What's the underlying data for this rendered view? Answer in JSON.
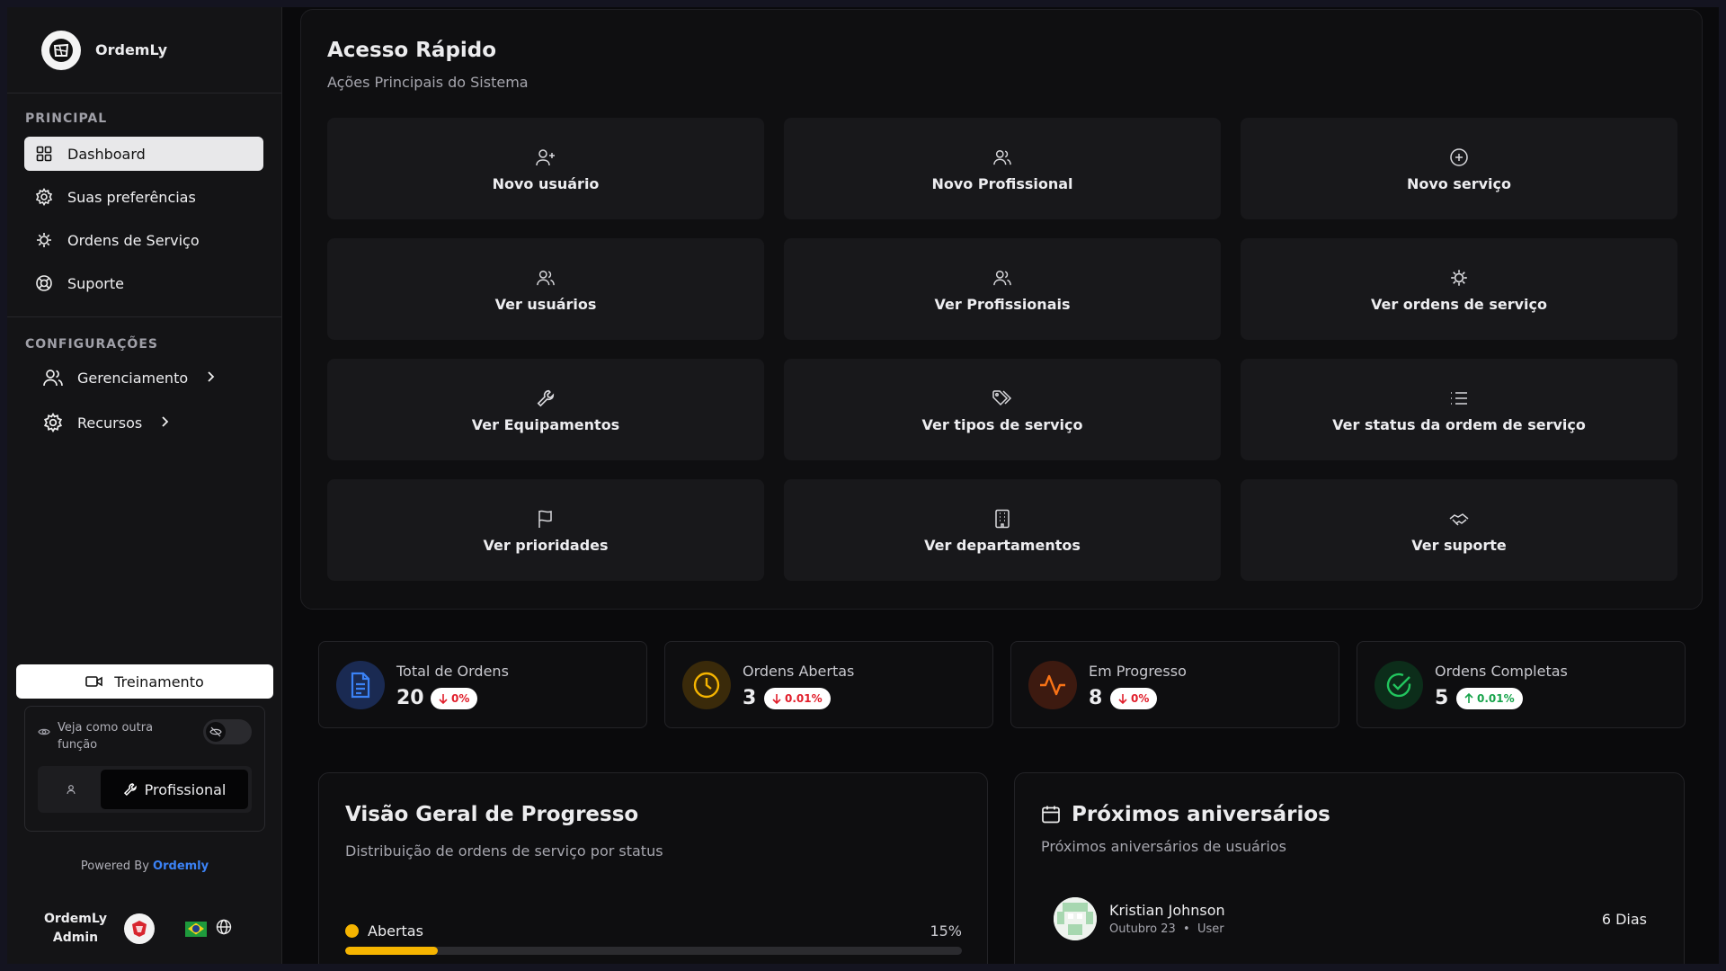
{
  "app": {
    "name": "OrdemLy"
  },
  "sidebar": {
    "principal_label": "PRINCIPAL",
    "items": [
      {
        "label": "Dashboard",
        "icon": "layout-grid-icon",
        "active": true
      },
      {
        "label": "Suas preferências",
        "icon": "settings-icon"
      },
      {
        "label": "Ordens de Serviço",
        "icon": "cog-icon"
      },
      {
        "label": "Suporte",
        "icon": "life-buoy-icon"
      }
    ],
    "config_label": "CONFIGURAÇÕES",
    "config_items": [
      {
        "label": "Gerenciamento",
        "icon": "users-icon"
      },
      {
        "label": "Recursos",
        "icon": "settings-icon"
      }
    ],
    "training_label": "Treinamento",
    "role_view_label": "Veja como outra função",
    "role_active": "Profissional",
    "powered_prefix": "Powered By",
    "powered_brand": "Ordemly",
    "user_name_line1": "OrdemLy",
    "user_name_line2": "Admin"
  },
  "quick_access": {
    "title": "Acesso Rápido",
    "subtitle": "Ações Principais do Sistema",
    "tiles": [
      {
        "label": "Novo usuário",
        "icon": "user-plus-icon"
      },
      {
        "label": "Novo Profissional",
        "icon": "users-icon"
      },
      {
        "label": "Novo serviço",
        "icon": "plus-circle-icon"
      },
      {
        "label": "Ver usuários",
        "icon": "users-icon"
      },
      {
        "label": "Ver Profissionais",
        "icon": "users-icon"
      },
      {
        "label": "Ver ordens de serviço",
        "icon": "cog-icon"
      },
      {
        "label": "Ver Equipamentos",
        "icon": "wrench-icon"
      },
      {
        "label": "Ver tipos de serviço",
        "icon": "tags-icon"
      },
      {
        "label": "Ver status da ordem de serviço",
        "icon": "list-icon"
      },
      {
        "label": "Ver prioridades",
        "icon": "flag-icon"
      },
      {
        "label": "Ver departamentos",
        "icon": "building-icon"
      },
      {
        "label": "Ver suporte",
        "icon": "handshake-icon"
      }
    ]
  },
  "stats": [
    {
      "label": "Total de Ordens",
      "value": "20",
      "change": "0%",
      "direction": "down",
      "color": "#3b82f6",
      "icon": "file-text-icon"
    },
    {
      "label": "Ordens Abertas",
      "value": "3",
      "change": "0.01%",
      "direction": "down",
      "color": "#f5b400",
      "icon": "clock-icon"
    },
    {
      "label": "Em Progresso",
      "value": "8",
      "change": "0%",
      "direction": "down",
      "color": "#f97316",
      "icon": "activity-icon"
    },
    {
      "label": "Ordens Completas",
      "value": "5",
      "change": "0.01%",
      "direction": "up",
      "color": "#22c55e",
      "icon": "check-circle-icon"
    }
  ],
  "progress": {
    "title": "Visão Geral de Progresso",
    "subtitle": "Distribuição de ordens de serviço por status",
    "rows": [
      {
        "label": "Abertas",
        "percent_label": "15%",
        "percent": 15,
        "color": "#f5b400"
      }
    ]
  },
  "birthdays": {
    "title": "Próximos aniversários",
    "subtitle": "Próximos aniversários de usuários",
    "items": [
      {
        "name": "Kristian Johnson",
        "date": "Outubro 23",
        "role": "User",
        "days": "6 Dias"
      }
    ]
  }
}
